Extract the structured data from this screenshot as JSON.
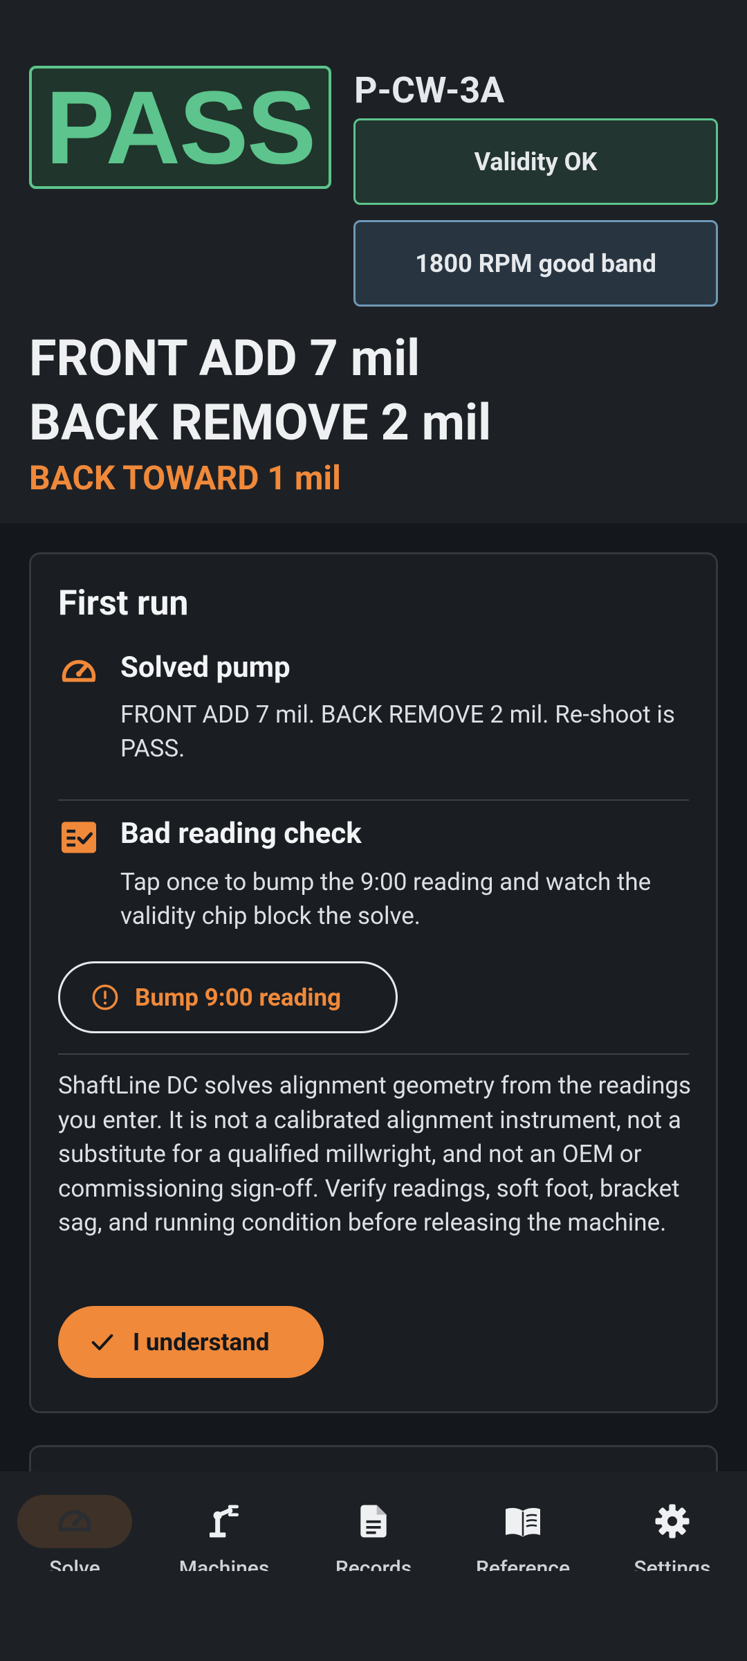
{
  "header": {
    "verdict": "PASS",
    "machine_id": "P-CW-3A",
    "validity_chip": "Validity OK",
    "rpm_chip": "1800 RPM good band",
    "front_move": "FRONT ADD 7 mil",
    "back_move": "BACK REMOVE 2 mil",
    "side_move": "BACK TOWARD 1 mil"
  },
  "card": {
    "title": "First run",
    "steps": [
      {
        "icon": "speedometer-icon",
        "title": "Solved pump",
        "text": "FRONT ADD 7 mil. BACK REMOVE 2 mil. Re-shoot is PASS."
      },
      {
        "icon": "checklist-icon",
        "title": "Bad reading check",
        "text": "Tap once to bump the 9:00 reading and watch the validity chip block the solve."
      }
    ],
    "bump_button": "Bump 9:00 reading",
    "disclaimer": "ShaftLine DC solves alignment geometry from the readings you enter. It is not a calibrated alignment instrument, not a substitute for a qualified millwright, and not an OEM or commissioning sign-off. Verify readings, soft foot, bracket sag, and running condition before releasing the machine.",
    "understand_button": "I understand"
  },
  "nav": {
    "items": [
      {
        "label": "Solve",
        "icon": "speedometer-icon",
        "active": true
      },
      {
        "label": "Machines",
        "icon": "robot-arm-icon",
        "active": false
      },
      {
        "label": "Records",
        "icon": "document-icon",
        "active": false
      },
      {
        "label": "Reference",
        "icon": "book-icon",
        "active": false
      },
      {
        "label": "Settings",
        "icon": "gear-icon",
        "active": false
      }
    ]
  },
  "colors": {
    "pass_green": "#5cc48c",
    "accent_orange": "#f0893a",
    "rpm_blue": "#6f98b6",
    "background": "#14171b"
  }
}
